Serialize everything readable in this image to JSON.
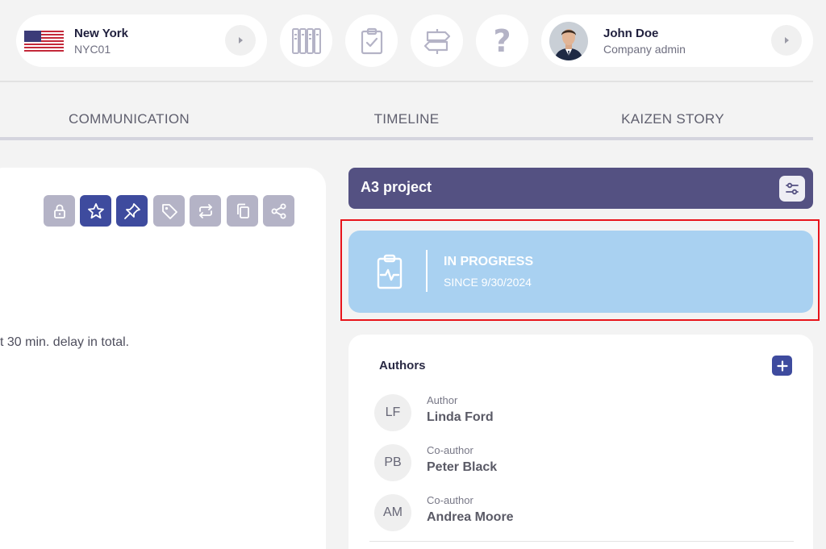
{
  "location": {
    "city": "New York",
    "code": "NYC01"
  },
  "user": {
    "name": "John Doe",
    "role": "Company admin"
  },
  "header_icons": [
    "columns-icon",
    "clipboard-check-icon",
    "signpost-icon",
    "help-icon"
  ],
  "help_glyph": "?",
  "tabs": [
    {
      "label": "COMMUNICATION"
    },
    {
      "label": "TIMELINE"
    },
    {
      "label": "KAIZEN STORY"
    }
  ],
  "toolbar": [
    "lock-icon",
    "star-icon",
    "pin-icon",
    "tag-icon",
    "repeat-icon",
    "copy-icon",
    "share-icon"
  ],
  "content": {
    "snippet": "t 30 min. delay in total."
  },
  "project": {
    "title": "A3 project",
    "status": "IN PROGRESS",
    "since": "SINCE 9/30/2024"
  },
  "authors": {
    "title": "Authors",
    "items": [
      {
        "initials": "LF",
        "role": "Author",
        "name": "Linda Ford"
      },
      {
        "initials": "PB",
        "role": "Co-author",
        "name": "Peter Black"
      },
      {
        "initials": "AM",
        "role": "Co-author",
        "name": "Andrea Moore"
      }
    ]
  },
  "colors": {
    "accent": "#3e4b9e",
    "header_purple": "#545182",
    "status_blue": "#a9d1f1",
    "highlight_red": "#e8141b"
  }
}
